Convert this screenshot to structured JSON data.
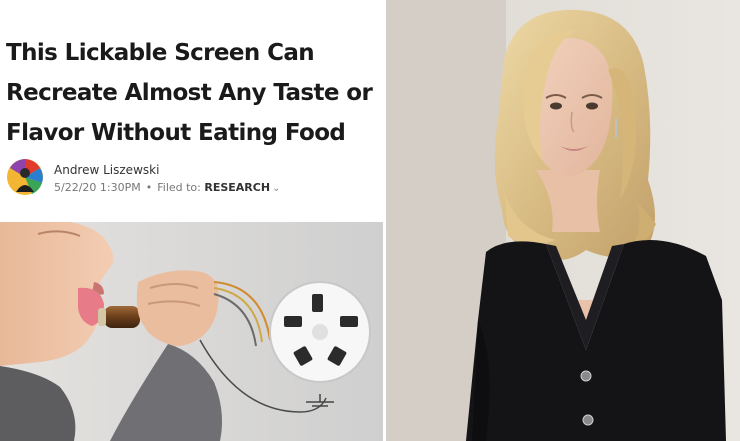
{
  "article": {
    "headline": "This Lickable Screen Can Recreate Almost Any Taste or Flavor Without Eating Food",
    "author": "Andrew Liszewski",
    "timestamp": "5/22/20 1:30PM",
    "separator": "•",
    "filed_label": "Filed to:",
    "category": "RESEARCH",
    "category_icon": "chevron-down-icon"
  },
  "images": {
    "article_photo": "child-licking-taste-device-photo",
    "portrait": "blonde-woman-black-dress-portrait"
  }
}
